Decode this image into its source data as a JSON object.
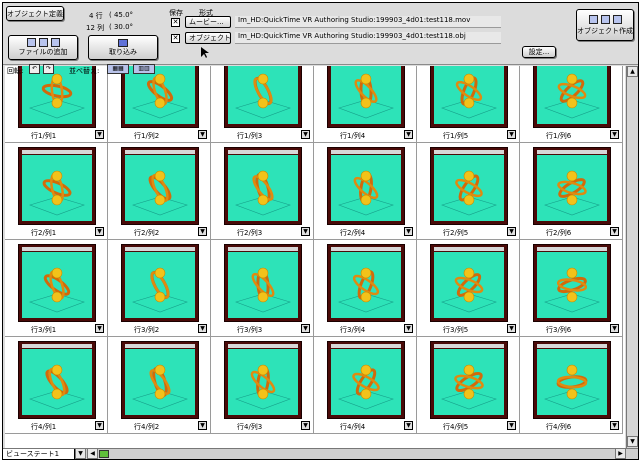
{
  "toolbar": {
    "object_define_label": "オブジェクト定義",
    "rows_text": "4 行",
    "rows_angle": "(   45.0° ",
    "cols_text": "12 列",
    "cols_angle": "(   30.0° ",
    "add_files_label": "ファイルの追加",
    "capture_label": "取り込み",
    "save_label": "保存",
    "format_label": "形式",
    "movie_button": "ムービー...",
    "object_button": "オブジェクト...",
    "movie_path": "Im_HD:QuickTime VR Authoring Studio:199903_4d01:test118.mov",
    "object_path": "Im_HD:QuickTime VR Authoring Studio:199903_4d01:test118.obj",
    "settings_button": "設定...",
    "create_object_label": "オブジェクト作成",
    "rotate_label": "回転:",
    "sort_label": "並べ替え:"
  },
  "view_state": "ビューステート1",
  "cells": [
    {
      "label": "行1/列1"
    },
    {
      "label": "行1/列2"
    },
    {
      "label": "行1/列3"
    },
    {
      "label": "行1/列4"
    },
    {
      "label": "行1/列5"
    },
    {
      "label": "行1/列6"
    },
    {
      "label": "行2/列1"
    },
    {
      "label": "行2/列2"
    },
    {
      "label": "行2/列3"
    },
    {
      "label": "行2/列4"
    },
    {
      "label": "行2/列5"
    },
    {
      "label": "行2/列6"
    },
    {
      "label": "行3/列1"
    },
    {
      "label": "行3/列2"
    },
    {
      "label": "行3/列3"
    },
    {
      "label": "行3/列4"
    },
    {
      "label": "行3/列5"
    },
    {
      "label": "行3/列6"
    },
    {
      "label": "行4/列1"
    },
    {
      "label": "行4/列2"
    },
    {
      "label": "行4/列3"
    },
    {
      "label": "行4/列4"
    },
    {
      "label": "行4/列5"
    },
    {
      "label": "行4/列6"
    }
  ],
  "colors": {
    "screen": "#2de3b8",
    "frame": "#4a0a08",
    "object": "#f2c21a"
  },
  "icons": {
    "checkbox": "checkbox-checked-icon",
    "cursor": "arrow-cursor-icon"
  }
}
